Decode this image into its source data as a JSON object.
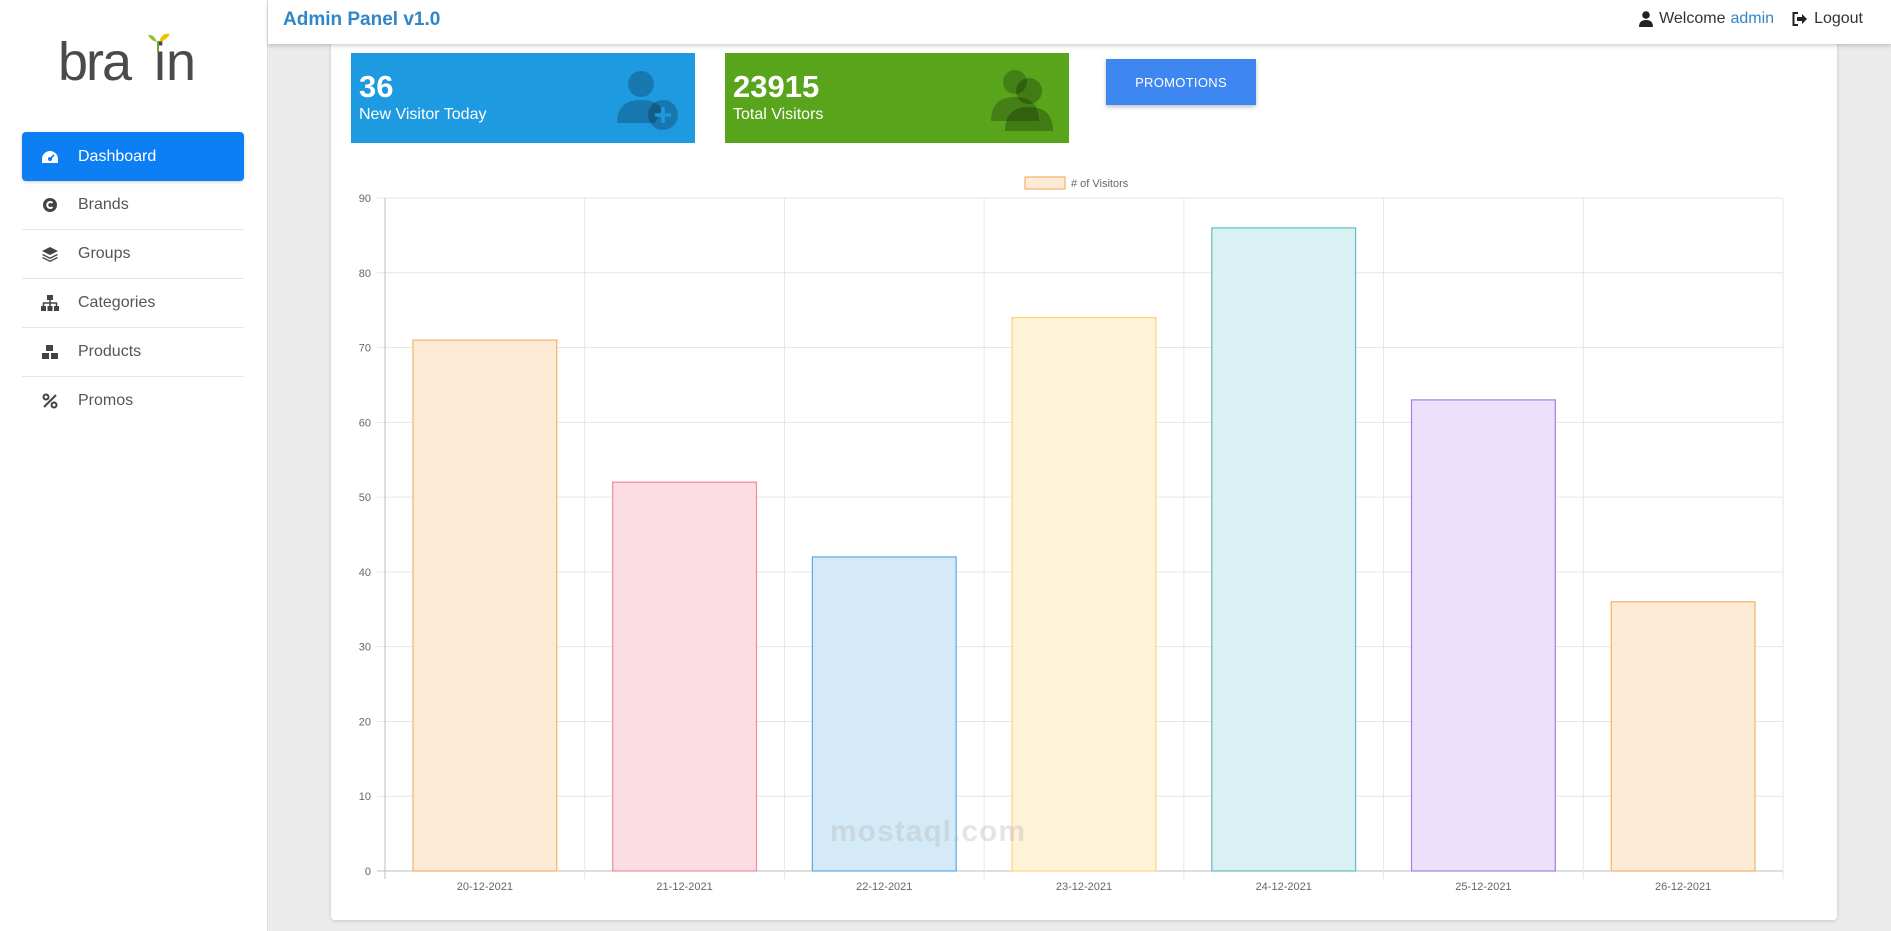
{
  "sidebar": {
    "items": [
      {
        "label": "Dashboard",
        "icon": "dashboard-icon",
        "active": true
      },
      {
        "label": "Brands",
        "icon": "copyright-icon"
      },
      {
        "label": "Groups",
        "icon": "layers-icon"
      },
      {
        "label": "Categories",
        "icon": "sitemap-icon"
      },
      {
        "label": "Products",
        "icon": "boxes-icon"
      },
      {
        "label": "Promos",
        "icon": "percent-icon"
      }
    ]
  },
  "header": {
    "title": "Admin Panel v1.0",
    "welcome_label": "Welcome",
    "user": "admin",
    "logout_label": "Logout"
  },
  "stats": [
    {
      "value": "36",
      "label": "New Visitor Today",
      "color": "#1e9ae0",
      "icon": "user-plus-icon"
    },
    {
      "value": "23915",
      "label": "Total Visitors",
      "color": "#58a51c",
      "icon": "users-icon"
    }
  ],
  "promotions_button": "PROMOTIONS",
  "watermark": "mostaql.com",
  "chart_data": {
    "type": "bar",
    "categories": [
      "20-12-2021",
      "21-12-2021",
      "22-12-2021",
      "23-12-2021",
      "24-12-2021",
      "25-12-2021",
      "26-12-2021"
    ],
    "series": [
      {
        "name": "# of Visitors",
        "values": [
          71,
          52,
          42,
          74,
          86,
          63,
          36
        ]
      }
    ],
    "ylim": [
      0,
      90
    ],
    "yticks": [
      0,
      10,
      20,
      30,
      40,
      50,
      60,
      70,
      80,
      90
    ],
    "grid": true,
    "legend": "top-center",
    "bar_fills": [
      "#fdebd6",
      "#fddde4",
      "#d5eaf9",
      "#fef3d9",
      "#d9f1f2",
      "#ebe1fd",
      "#fdebd6"
    ],
    "bar_strokes": [
      "#f5b16a",
      "#f28aa2",
      "#62a8df",
      "#fcd575",
      "#5fbfc0",
      "#a77ae8",
      "#f5b16a"
    ]
  }
}
